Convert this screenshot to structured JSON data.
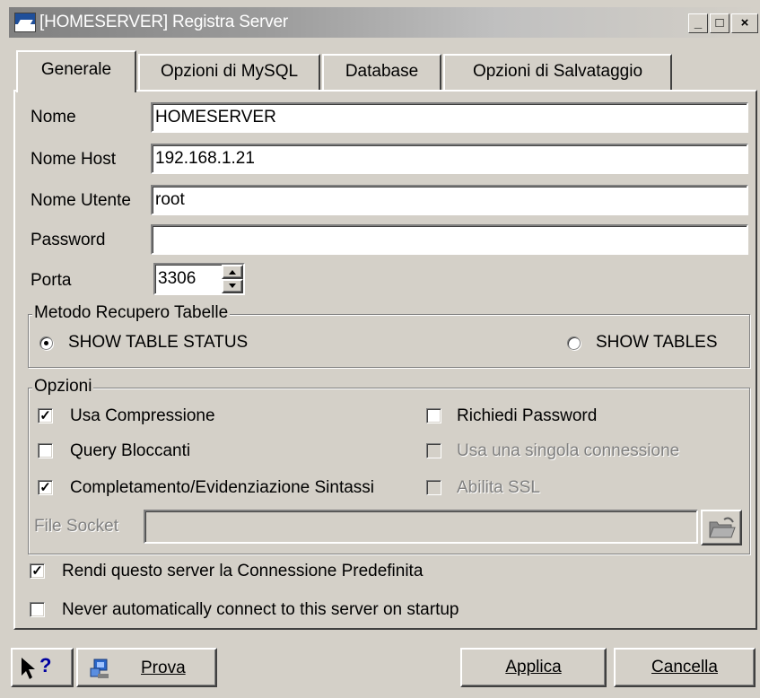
{
  "window": {
    "title": "[HOMESERVER] Registra Server",
    "min": "_",
    "max": "□",
    "close": "×"
  },
  "tabs": [
    {
      "label": "Generale"
    },
    {
      "label": "Opzioni di MySQL"
    },
    {
      "label": "Database"
    },
    {
      "label": "Opzioni di Salvataggio"
    }
  ],
  "form": {
    "name_label": "Nome",
    "name_value": "HOMESERVER",
    "host_label": "Nome Host",
    "host_value": "192.168.1.21",
    "user_label": "Nome Utente",
    "user_value": "root",
    "password_label": "Password",
    "password_value": "",
    "port_label": "Porta",
    "port_value": "3306"
  },
  "retrieval": {
    "legend": "Metodo Recupero Tabelle",
    "option1": "SHOW TABLE STATUS",
    "option2": "SHOW TABLES"
  },
  "options": {
    "legend": "Opzioni",
    "compression": "Usa Compressione",
    "blocking": "Query Bloccanti",
    "syntax": "Completamento/Evidenziazione Sintassi",
    "require_password": "Richiedi Password",
    "single_connection": "Usa una singola connessione",
    "ssl": "Abilita SSL",
    "socket_label": "File Socket"
  },
  "bottom": {
    "default_connection": "Rendi questo server la Connessione Predefinita",
    "never_connect": "Never automatically connect to this server on startup"
  },
  "buttons": {
    "help": "?",
    "test": "Prova",
    "apply": "Applica",
    "cancel": "Cancella"
  }
}
